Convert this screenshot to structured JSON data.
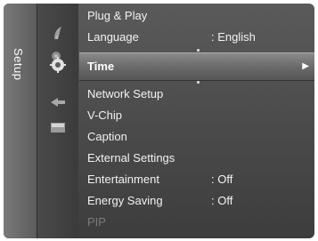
{
  "side_tab": {
    "label": "Setup"
  },
  "icons": [
    {
      "name": "picture-icon"
    },
    {
      "name": "sound-icon"
    },
    {
      "name": "setup-icon",
      "active": true
    },
    {
      "name": "input-icon"
    },
    {
      "name": "application-icon"
    }
  ],
  "menu": {
    "items": [
      {
        "label": "Plug & Play",
        "value": ""
      },
      {
        "label": "Language",
        "value": ": English"
      },
      {
        "label": "Time",
        "value": "",
        "selected": true,
        "arrow": "▶"
      },
      {
        "label": "Network Setup",
        "value": ""
      },
      {
        "label": "V-Chip",
        "value": ""
      },
      {
        "label": "Caption",
        "value": ""
      },
      {
        "label": "External Settings",
        "value": ""
      },
      {
        "label": "Entertainment",
        "value": ": Off"
      },
      {
        "label": "Energy Saving",
        "value": ": Off"
      },
      {
        "label": "PIP",
        "value": "",
        "disabled": true
      }
    ]
  },
  "colors": {
    "background": "#3d3d3d",
    "highlight": "#6b6b6b",
    "text": "#f2f2f2",
    "disabled_text": "#7a7a7a"
  }
}
